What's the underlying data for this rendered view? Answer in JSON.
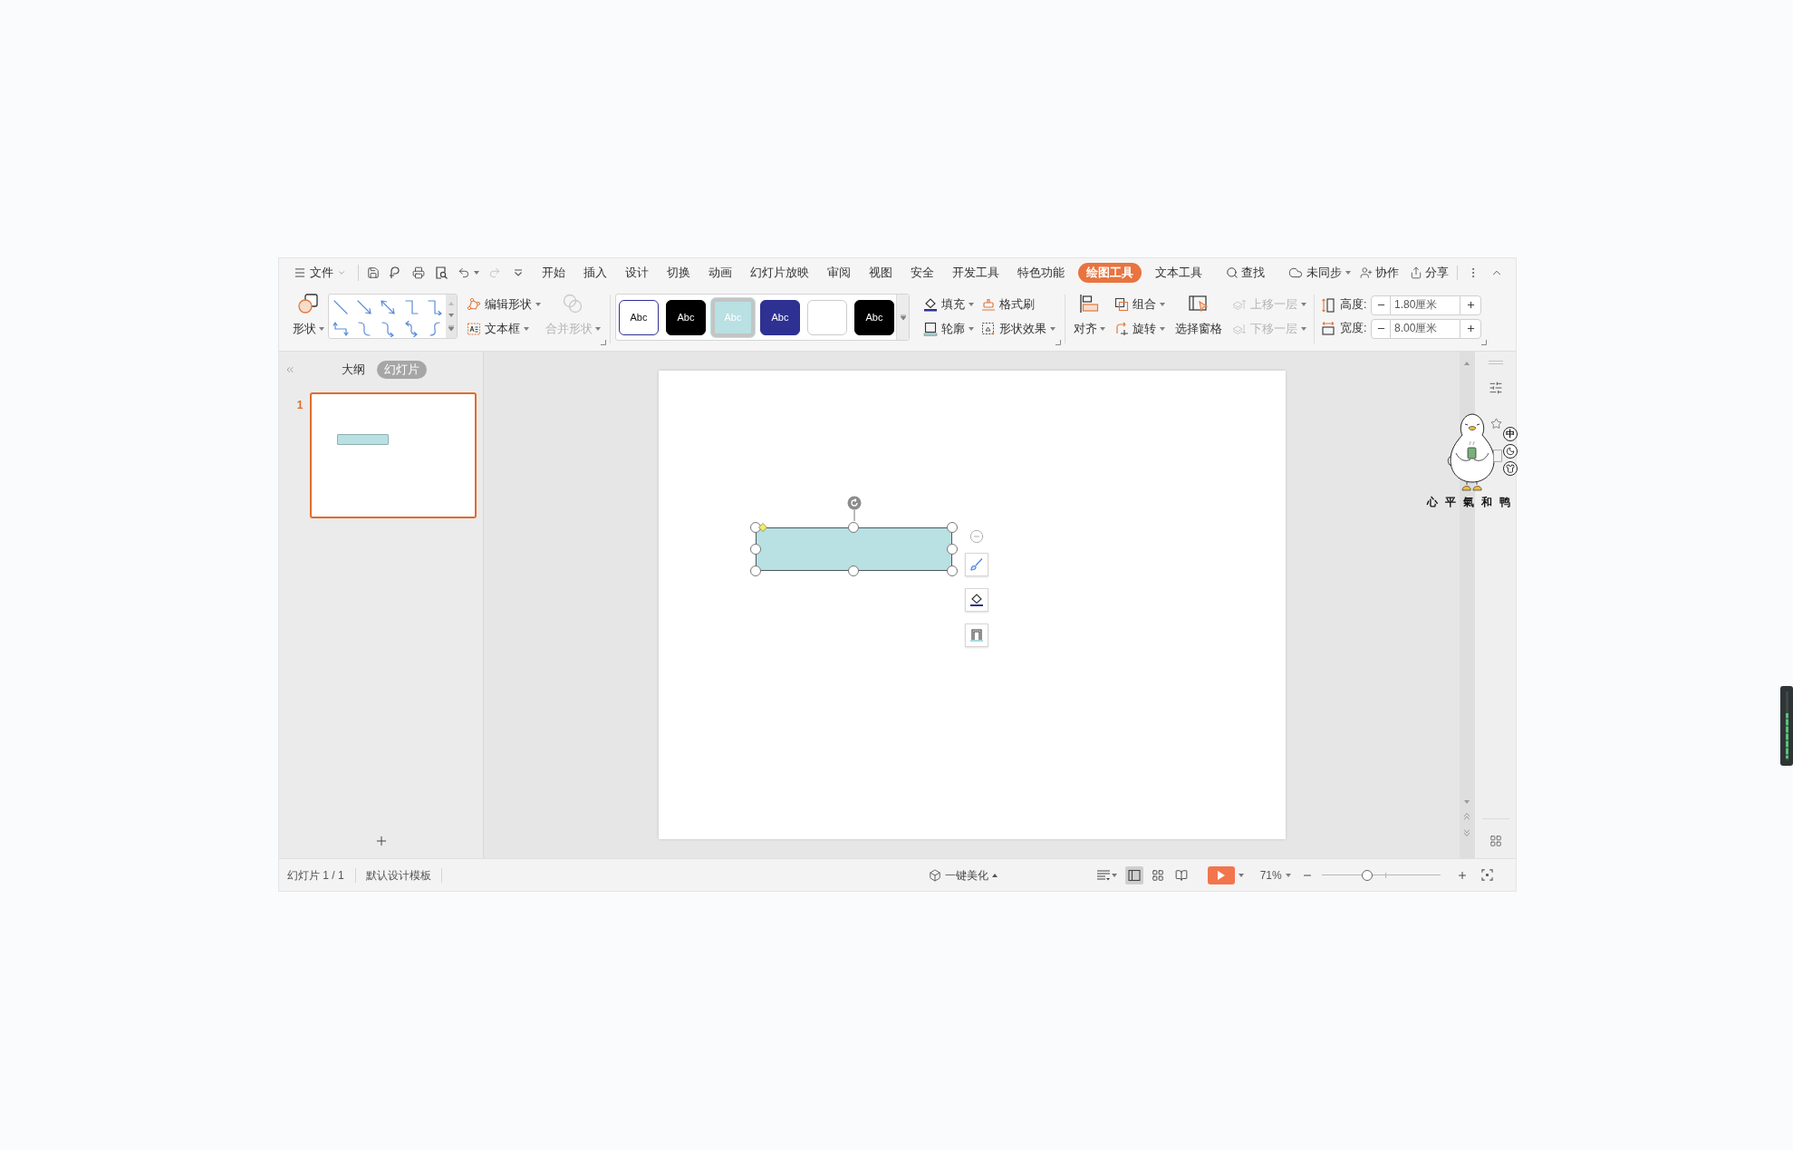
{
  "menu_bar": {
    "file_menu": "文件",
    "tabs": [
      {
        "label": "开始",
        "selected": false
      },
      {
        "label": "插入",
        "selected": false
      },
      {
        "label": "设计",
        "selected": false
      },
      {
        "label": "切换",
        "selected": false
      },
      {
        "label": "动画",
        "selected": false
      },
      {
        "label": "幻灯片放映",
        "selected": false
      },
      {
        "label": "审阅",
        "selected": false
      },
      {
        "label": "视图",
        "selected": false
      },
      {
        "label": "安全",
        "selected": false
      },
      {
        "label": "开发工具",
        "selected": false
      },
      {
        "label": "特色功能",
        "selected": false
      },
      {
        "label": "绘图工具",
        "selected": true
      },
      {
        "label": "文本工具",
        "selected": false
      }
    ],
    "search": "查找",
    "sync": "未同步",
    "collaborate": "协作",
    "share": "分享"
  },
  "ribbon": {
    "shapes": {
      "label": "形状",
      "disabled": false
    },
    "edit_shape": {
      "label": "编辑形状",
      "disabled": false
    },
    "text_box": {
      "label": "文本框",
      "disabled": false
    },
    "merge_shapes": {
      "label": "合并形状",
      "disabled": true
    },
    "style_swatches": [
      {
        "kind": "outline",
        "label": "Abc",
        "color": "#2e3192",
        "selected": false
      },
      {
        "kind": "filled",
        "label": "Abc",
        "color": "#000000",
        "selected": false
      },
      {
        "kind": "filled",
        "label": "Abc",
        "color": "#b9e0e2",
        "selected": true
      },
      {
        "kind": "filled",
        "label": "Abc",
        "color": "#2e3192",
        "selected": false
      },
      {
        "kind": "outline",
        "color": "#cccccc",
        "selected": false
      },
      {
        "kind": "filled",
        "label": "Abc",
        "color": "#000000",
        "selected": false
      }
    ],
    "fill": {
      "label": "填充",
      "disabled": false
    },
    "format_painter": {
      "label": "格式刷",
      "disabled": false
    },
    "outline": {
      "label": "轮廓",
      "disabled": false
    },
    "shape_effects": {
      "label": "形状效果",
      "disabled": false
    },
    "align": {
      "label": "对齐",
      "disabled": false
    },
    "group": {
      "label": "组合",
      "disabled": false
    },
    "rotate": {
      "label": "旋转",
      "disabled": false
    },
    "selection_pane": {
      "label": "选择窗格",
      "disabled": false
    },
    "bring_forward": {
      "label": "上移一层",
      "disabled": true
    },
    "send_backward": {
      "label": "下移一层",
      "disabled": true
    },
    "height": {
      "label": "高度:",
      "value": "1.80厘米"
    },
    "width": {
      "label": "宽度:",
      "value": "8.00厘米"
    }
  },
  "slides_panel": {
    "tabs": [
      {
        "label": "大纲",
        "selected": false
      },
      {
        "label": "幻灯片",
        "selected": true
      }
    ],
    "slides": [
      {
        "number": "1",
        "selected": true
      }
    ]
  },
  "canvas": {
    "shape": {
      "selected": true
    }
  },
  "status_bar": {
    "slide_counter": "幻灯片 1 / 1",
    "template": "默认设计模板",
    "beautify": "一键美化",
    "views": [
      {
        "kind": "normal",
        "selected": true
      },
      {
        "kind": "sorter",
        "selected": false
      },
      {
        "kind": "reading",
        "selected": false
      }
    ],
    "zoom": {
      "reading": "71%",
      "level": 0.37
    }
  },
  "ime_sticker": {
    "mode": "中",
    "caption": "心平氣和鸭"
  }
}
